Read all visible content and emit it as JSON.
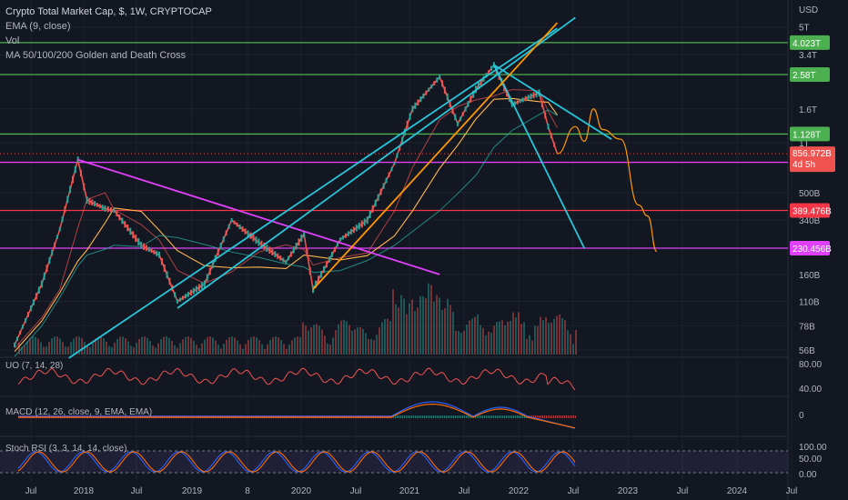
{
  "header": {
    "title": "Crypto Total Market Cap, $, 1W, CRYPTOCAP",
    "indicators": [
      "EMA (9, close)",
      "Vol",
      "MA 50/100/200 Golden and Death Cross"
    ]
  },
  "panes": {
    "uo": "UO (7, 14, 28)",
    "macd": "MACD (12, 26, close, 9, EMA, EMA)",
    "stoch": "Stoch RSI (3, 3, 14, 14, close)"
  },
  "colors": {
    "background": "#131722",
    "up": "#26a69a",
    "down": "#ef5350",
    "green_line": "#4caf50",
    "red_line": "#f23645",
    "magenta": "#e040fb",
    "cyan": "#26c6da",
    "orange": "#ff9800",
    "yellow": "#ffb74d",
    "macd": "#2962ff",
    "signal": "#ff6d00"
  },
  "chart_data": {
    "type": "line",
    "title": "Crypto Total Market Cap, $, 1W, CRYPTOCAP",
    "scale": "log",
    "price_axis": {
      "unit_label": "USD",
      "ticks": [
        "5T",
        "3.4T",
        "1.6T",
        "1T",
        "500B",
        "340B",
        "160B",
        "110B",
        "78B",
        "56B"
      ]
    },
    "x_tick_labels": [
      "Jul",
      "2018",
      "Jul",
      "2019",
      "8",
      "2020",
      "Jul",
      "2021",
      "Jul",
      "2022",
      "Jul",
      "2023",
      "Jul",
      "2024",
      "Jul"
    ],
    "horizontal_levels": [
      {
        "label": "4.023T",
        "value": 4023000000000.0,
        "color": "#4caf50"
      },
      {
        "label": "2.58T",
        "value": 2580000000000.0,
        "color": "#4caf50"
      },
      {
        "label": "1.128T",
        "value": 1128000000000.0,
        "color": "#4caf50"
      },
      {
        "label": "760.911B",
        "value": 760911000000.0,
        "color": "#e040fb"
      },
      {
        "label": "389.476B",
        "value": 389476000000.0,
        "color": "#f23645"
      },
      {
        "label": "230.456B",
        "value": 230456000000.0,
        "color": "#e040fb"
      }
    ],
    "last_price": {
      "label": "856.972B",
      "countdown": "4d 5h",
      "value": 856972000000.0
    },
    "price_path": [
      {
        "date": "2017-06",
        "value": 60000000000.0
      },
      {
        "date": "2017-09",
        "value": 140000000000.0
      },
      {
        "date": "2017-11",
        "value": 300000000000.0
      },
      {
        "date": "2018-01",
        "value": 790000000000.0
      },
      {
        "date": "2018-02",
        "value": 450000000000.0
      },
      {
        "date": "2018-04",
        "value": 400000000000.0
      },
      {
        "date": "2018-05",
        "value": 390000000000.0
      },
      {
        "date": "2018-08",
        "value": 240000000000.0
      },
      {
        "date": "2018-10",
        "value": 210000000000.0
      },
      {
        "date": "2018-12",
        "value": 110000000000.0
      },
      {
        "date": "2019-03",
        "value": 140000000000.0
      },
      {
        "date": "2019-06",
        "value": 340000000000.0
      },
      {
        "date": "2019-09",
        "value": 250000000000.0
      },
      {
        "date": "2019-12",
        "value": 190000000000.0
      },
      {
        "date": "2020-02",
        "value": 280000000000.0
      },
      {
        "date": "2020-03",
        "value": 130000000000.0
      },
      {
        "date": "2020-06",
        "value": 260000000000.0
      },
      {
        "date": "2020-09",
        "value": 340000000000.0
      },
      {
        "date": "2020-12",
        "value": 750000000000.0
      },
      {
        "date": "2021-02",
        "value": 1600000000000.0
      },
      {
        "date": "2021-05",
        "value": 2500000000000.0
      },
      {
        "date": "2021-07",
        "value": 1300000000000.0
      },
      {
        "date": "2021-09",
        "value": 2100000000000.0
      },
      {
        "date": "2021-11",
        "value": 2950000000000.0
      },
      {
        "date": "2022-01",
        "value": 1700000000000.0
      },
      {
        "date": "2022-04",
        "value": 2000000000000.0
      },
      {
        "date": "2022-05",
        "value": 1250000000000.0
      },
      {
        "date": "2022-06",
        "value": 857000000000.0
      }
    ],
    "projection_path": [
      {
        "date": "2022-06",
        "value": 857000000000.0
      },
      {
        "date": "2022-08",
        "value": 1250000000000.0
      },
      {
        "date": "2022-09",
        "value": 1020000000000.0
      },
      {
        "date": "2022-10",
        "value": 1600000000000.0
      },
      {
        "date": "2022-11",
        "value": 1200000000000.0
      },
      {
        "date": "2023-01",
        "value": 1050000000000.0
      },
      {
        "date": "2023-03",
        "value": 420000000000.0
      },
      {
        "date": "2023-04",
        "value": 360000000000.0
      },
      {
        "date": "2023-05",
        "value": 220000000000.0
      }
    ],
    "trend_lines": [
      {
        "color": "#e040fb",
        "from": {
          "date": "2018-01",
          "value": 790000000000.0
        },
        "to": {
          "date": "2021-05",
          "value": 160000000000.0
        }
      },
      {
        "color": "#26c6da",
        "from": {
          "date": "2017-12",
          "value": 50000000000.0
        },
        "to": {
          "date": "2022-06",
          "value": 4900000000000.0
        }
      },
      {
        "color": "#26c6da",
        "from": {
          "date": "2018-12",
          "value": 100000000000.0
        },
        "to": {
          "date": "2022-08",
          "value": 5700000000000.0
        }
      },
      {
        "color": "#26c6da",
        "from": {
          "date": "2021-11",
          "value": 2950000000000.0
        },
        "to": {
          "date": "2022-12",
          "value": 1050000000000.0
        }
      },
      {
        "color": "#26c6da",
        "from": {
          "date": "2021-11",
          "value": 2950000000000.0
        },
        "to": {
          "date": "2022-09",
          "value": 230000000000.0
        }
      },
      {
        "color": "#ff9800",
        "from": {
          "date": "2020-03",
          "value": 130000000000.0
        },
        "to": {
          "date": "2022-06",
          "value": 5300000000000.0
        }
      }
    ],
    "uo_pane": {
      "ticks": [
        "80.00",
        "40.00"
      ]
    },
    "macd_pane": {
      "ticks": [
        "0"
      ]
    },
    "stoch_pane": {
      "ticks": [
        "100.00",
        "50.00",
        "0.00"
      ]
    }
  }
}
